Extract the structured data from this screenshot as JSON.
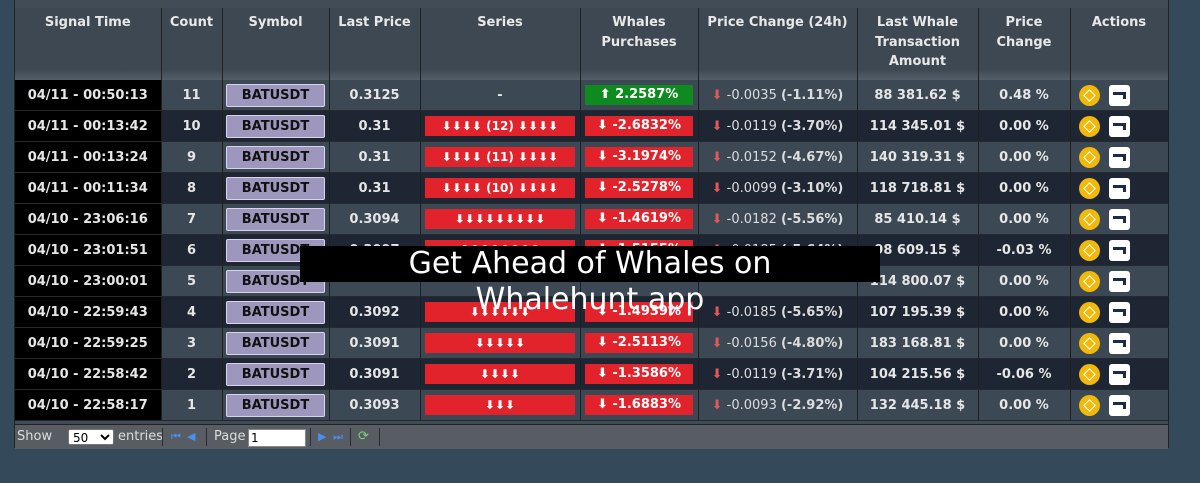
{
  "headers": {
    "signal_time": "Signal Time",
    "count": "Count",
    "symbol": "Symbol",
    "last_price": "Last Price",
    "series": "Series",
    "whales_purchases": "Whales Purchases",
    "price_change_24h": "Price Change (24h)",
    "last_whale_amount": "Last Whale Transaction Amount",
    "price_change": "Price Change",
    "actions": "Actions"
  },
  "rows": [
    {
      "time": "04/11 - 00:50:13",
      "count": "11",
      "symbol": "BATUSDT",
      "last_price": "0.3125",
      "price_dir": "up",
      "series": "-",
      "whales": "⬆ 2.2587%",
      "whales_dir": "up",
      "pc24_delta": "-0.0035",
      "pc24_pct": "(-1.11%)",
      "amount": "88 381.62 $",
      "change": "0.48 %"
    },
    {
      "time": "04/11 - 00:13:42",
      "count": "10",
      "symbol": "BATUSDT",
      "last_price": "0.31",
      "price_dir": "down",
      "series": "⬇⬇⬇⬇ (12) ⬇⬇⬇⬇",
      "whales": "⬇ -2.6832%",
      "whales_dir": "down",
      "pc24_delta": "-0.0119",
      "pc24_pct": "(-3.70%)",
      "amount": "114 345.01 $",
      "change": "0.00 %"
    },
    {
      "time": "04/11 - 00:13:24",
      "count": "9",
      "symbol": "BATUSDT",
      "last_price": "0.31",
      "price_dir": "down",
      "series": "⬇⬇⬇⬇ (11) ⬇⬇⬇⬇",
      "whales": "⬇ -3.1974%",
      "whales_dir": "down",
      "pc24_delta": "-0.0152",
      "pc24_pct": "(-4.67%)",
      "amount": "140 319.31 $",
      "change": "0.00 %"
    },
    {
      "time": "04/11 - 00:11:34",
      "count": "8",
      "symbol": "BATUSDT",
      "last_price": "0.31",
      "price_dir": "down",
      "series": "⬇⬇⬇⬇ (10) ⬇⬇⬇⬇",
      "whales": "⬇ -2.5278%",
      "whales_dir": "down",
      "pc24_delta": "-0.0099",
      "pc24_pct": "(-3.10%)",
      "amount": "118 718.81 $",
      "change": "0.00 %"
    },
    {
      "time": "04/10 - 23:06:16",
      "count": "7",
      "symbol": "BATUSDT",
      "last_price": "0.3094",
      "price_dir": "down",
      "series": "⬇⬇⬇⬇⬇⬇⬇⬇⬇",
      "whales": "⬇ -1.4619%",
      "whales_dir": "down",
      "pc24_delta": "-0.0182",
      "pc24_pct": "(-5.56%)",
      "amount": "85 410.14 $",
      "change": "0.00 %"
    },
    {
      "time": "04/10 - 23:01:51",
      "count": "6",
      "symbol": "BATUSDT",
      "last_price": "0.3097",
      "price_dir": "down",
      "series": "⬇⬇⬇⬇⬇⬇⬇⬇",
      "whales": "⬇ -1.5155%",
      "whales_dir": "down",
      "pc24_delta": "-0.0185",
      "pc24_pct": "(-5.64%)",
      "amount": "98 609.15 $",
      "change": "-0.03 %"
    },
    {
      "time": "04/10 - 23:00:01",
      "count": "5",
      "symbol": "BATUSDT",
      "last_price": "",
      "price_dir": "down",
      "series": "",
      "whales": "",
      "whales_dir": "down",
      "pc24_delta": "",
      "pc24_pct": "",
      "amount": "114 800.07 $",
      "change": "0.00 %"
    },
    {
      "time": "04/10 - 22:59:43",
      "count": "4",
      "symbol": "BATUSDT",
      "last_price": "0.3092",
      "price_dir": "down",
      "series": "⬇⬇⬇⬇⬇⬇",
      "whales": "⬇ -1.4939%",
      "whales_dir": "down",
      "pc24_delta": "-0.0185",
      "pc24_pct": "(-5.65%)",
      "amount": "107 195.39 $",
      "change": "0.00 %"
    },
    {
      "time": "04/10 - 22:59:25",
      "count": "3",
      "symbol": "BATUSDT",
      "last_price": "0.3091",
      "price_dir": "down",
      "series": "⬇⬇⬇⬇⬇",
      "whales": "⬇ -2.5113%",
      "whales_dir": "down",
      "pc24_delta": "-0.0156",
      "pc24_pct": "(-4.80%)",
      "amount": "183 168.81 $",
      "change": "0.00 %"
    },
    {
      "time": "04/10 - 22:58:42",
      "count": "2",
      "symbol": "BATUSDT",
      "last_price": "0.3091",
      "price_dir": "down",
      "series": "⬇⬇⬇⬇",
      "whales": "⬇ -1.3586%",
      "whales_dir": "down",
      "pc24_delta": "-0.0119",
      "pc24_pct": "(-3.71%)",
      "amount": "104 215.56 $",
      "change": "-0.06 %"
    },
    {
      "time": "04/10 - 22:58:17",
      "count": "1",
      "symbol": "BATUSDT",
      "last_price": "0.3093",
      "price_dir": "down",
      "series": "⬇⬇⬇",
      "whales": "⬇ -1.6883%",
      "whales_dir": "down",
      "pc24_delta": "-0.0093",
      "pc24_pct": "(-2.92%)",
      "amount": "132 445.18 $",
      "change": "0.00 %"
    }
  ],
  "pager": {
    "show_label": "Show",
    "page_size": "50",
    "page_size_options": [
      "50"
    ],
    "entries_label": "entries",
    "first_icon": "first-page-icon",
    "prev_icon": "prev-page-icon",
    "page_label": "Page",
    "page_value": "1",
    "next_icon": "next-page-icon",
    "last_icon": "last-page-icon",
    "refresh_icon": "refresh-icon"
  },
  "overlay_text": "Get Ahead of Whales on Whalehunt.app",
  "colors": {
    "up_green": "#0f8a1f",
    "down_red": "#e3232b",
    "price_up": "#5fbf5f",
    "price_down": "#ef6b6b"
  }
}
